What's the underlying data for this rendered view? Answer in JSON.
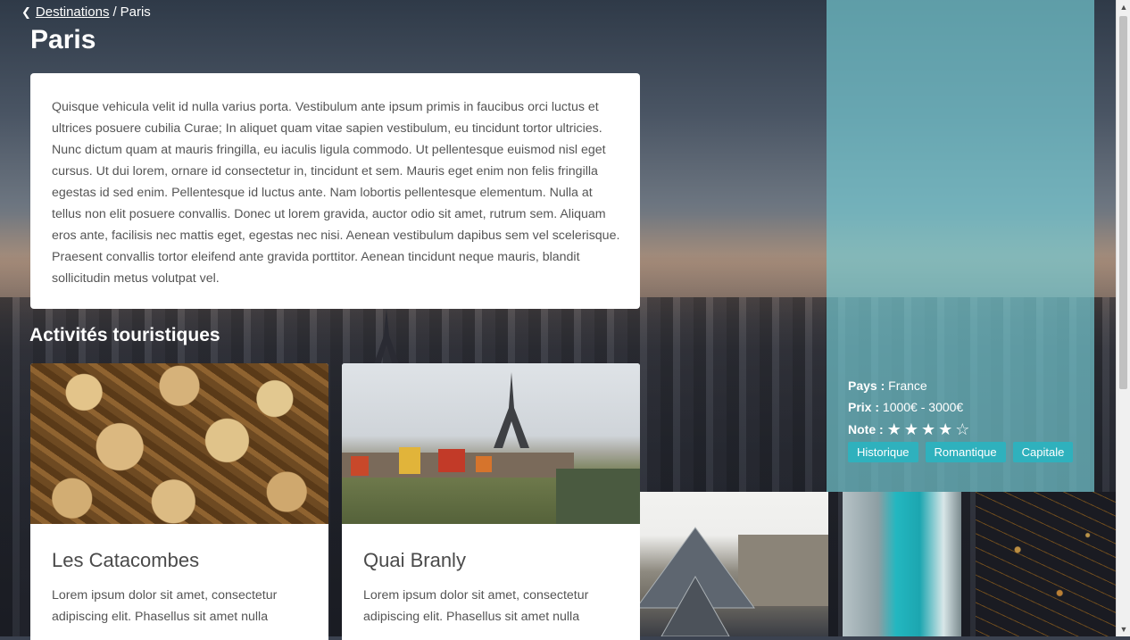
{
  "breadcrumb": {
    "parent": "Destinations",
    "separator": "/",
    "current": "Paris"
  },
  "page": {
    "title": "Paris",
    "description": "Quisque vehicula velit id nulla varius porta. Vestibulum ante ipsum primis in faucibus orci luctus et ultrices posuere cubilia Curae; In aliquet quam vitae sapien vestibulum, eu tincidunt tortor ultricies. Nunc dictum quam at mauris fringilla, eu iaculis ligula commodo. Ut pellentesque euismod nisl eget cursus. Ut dui lorem, ornare id consectetur in, tincidunt et sem. Mauris eget enim non felis fringilla egestas id sed enim. Pellentesque id luctus ante. Nam lobortis pellentesque elementum. Nulla at tellus non elit posuere convallis. Donec ut lorem gravida, auctor odio sit amet, rutrum sem. Aliquam eros ante, facilisis nec mattis eget, egestas nec nisi. Aenean vestibulum dapibus sem vel scelerisque. Praesent convallis tortor eleifend ante gravida porttitor. Aenean tincidunt neque mauris, blandit sollicitudin metus volutpat vel."
  },
  "activities": {
    "title": "Activités touristiques",
    "items": [
      {
        "name": "Les Catacombes",
        "text": "Lorem ipsum dolor sit amet, consectetur adipiscing elit. Phasellus sit amet nulla"
      },
      {
        "name": "Quai Branly",
        "text": "Lorem ipsum dolor sit amet, consectetur adipiscing elit. Phasellus sit amet nulla"
      }
    ]
  },
  "sidebar": {
    "country_label": "Pays :",
    "country": "France",
    "price_label": "Prix :",
    "price": "1000€ - 3000€",
    "rating_label": "Note :",
    "rating": 4,
    "rating_max": 5,
    "tags": [
      "Historique",
      "Romantique",
      "Capitale"
    ]
  },
  "colors": {
    "sidebar": "#76cdd6",
    "tag": "#2fb1bd"
  }
}
